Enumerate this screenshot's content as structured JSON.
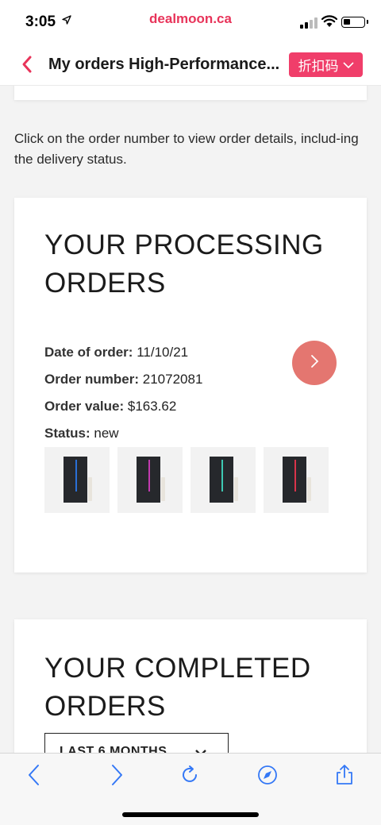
{
  "status_bar": {
    "time": "3:05",
    "location_icon": "location-arrow-icon",
    "domain": "dealmoon.ca",
    "signal_icon": "cellular-signal-icon",
    "wifi_icon": "wifi-icon",
    "battery_icon": "battery-icon"
  },
  "nav": {
    "back_icon": "chevron-left-icon",
    "title": "My orders High-Performance...",
    "coupon_label": "折扣码",
    "coupon_icon": "chevron-down-icon"
  },
  "intro_text": "Click on the order number to view order details, includ-ing the delivery status.",
  "processing": {
    "heading_line1": "YOUR PROCESSING",
    "heading_line2": "ORDERS",
    "date_label": "Date of order:",
    "date_value": "11/10/21",
    "number_label": "Order number:",
    "number_value": "21072081",
    "value_label": "Order value:",
    "value_value": "$163.62",
    "status_label": "Status:",
    "status_value": "new",
    "arrow_icon": "chevron-right-icon",
    "products": [
      {
        "name": "product-thumbnail-blue",
        "accent": "#2a6fd6"
      },
      {
        "name": "product-thumbnail-pink",
        "accent": "#c23ab0"
      },
      {
        "name": "product-thumbnail-teal",
        "accent": "#3ec9b3"
      },
      {
        "name": "product-thumbnail-red",
        "accent": "#d9334a"
      }
    ]
  },
  "completed": {
    "heading_line1": "YOUR COMPLETED",
    "heading_line2": "ORDERS",
    "filter_value": "LAST 6 MONTHS",
    "filter_icon": "chevron-down-icon"
  },
  "toolbar": {
    "back_icon": "back-arrow-icon",
    "forward_icon": "forward-arrow-icon",
    "reload_icon": "reload-icon",
    "compass_icon": "compass-icon",
    "share_icon": "share-icon"
  },
  "colors": {
    "brand": "#e8345a",
    "coupon_bg": "#f03e6a",
    "arrow_button": "#e47670",
    "toolbar_icon": "#3478f6"
  }
}
